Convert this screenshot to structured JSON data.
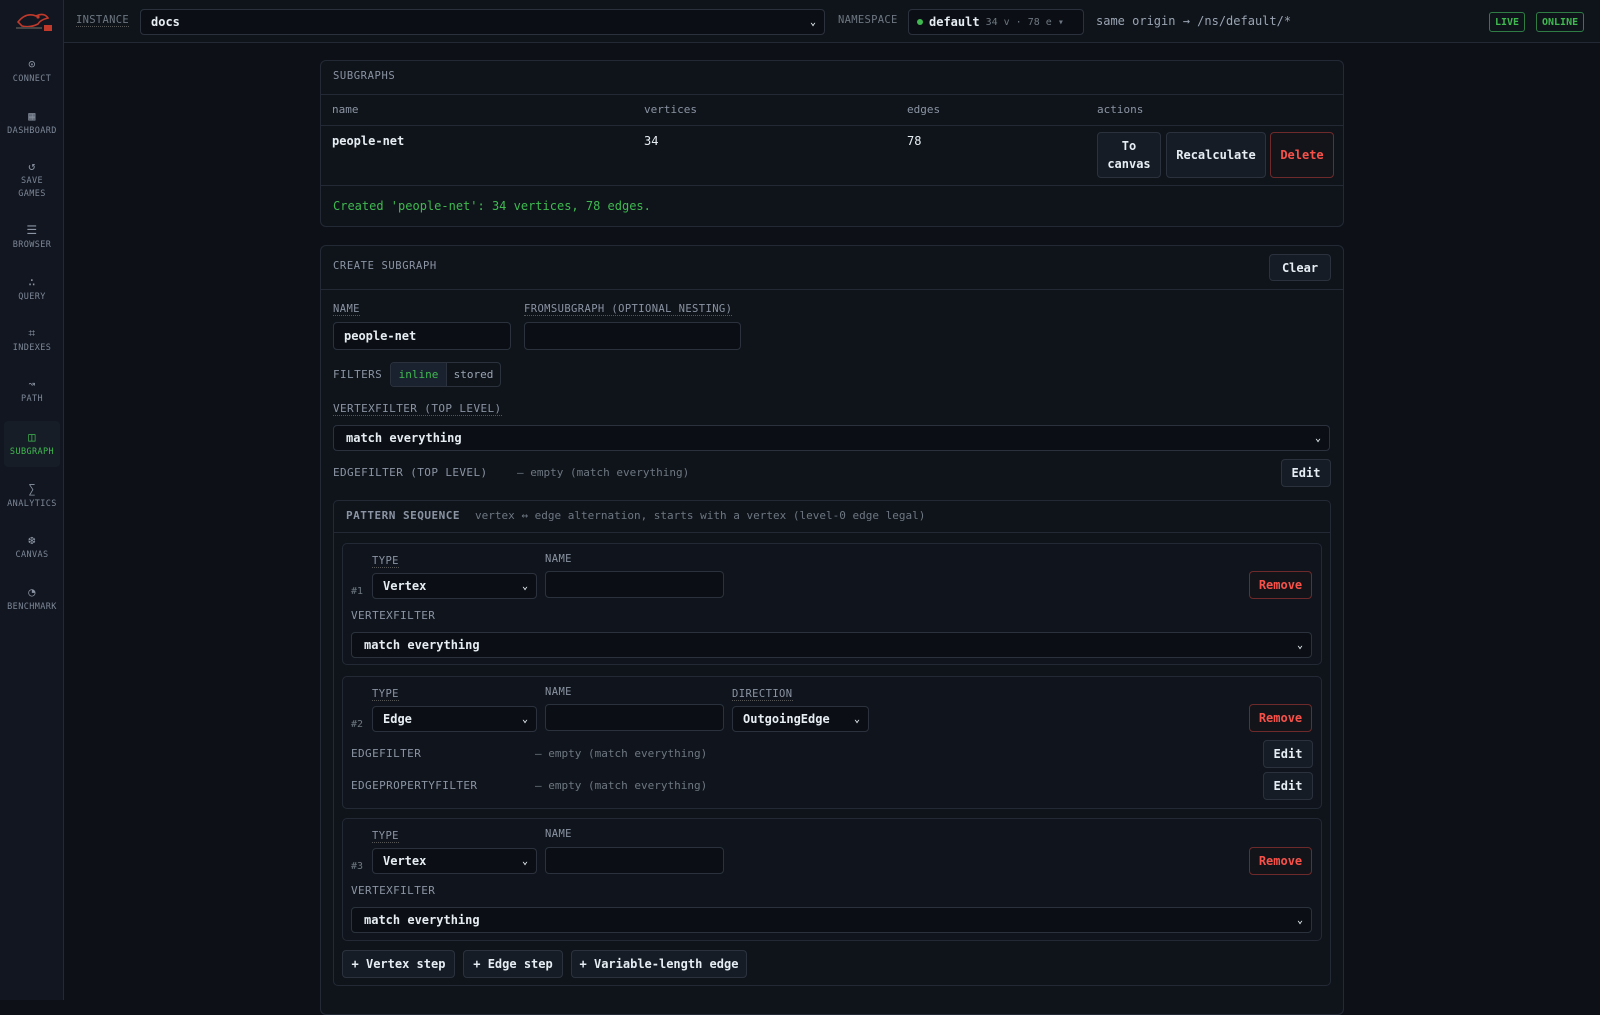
{
  "nav": [
    {
      "label": "CONNECT",
      "icon": "⊙"
    },
    {
      "label": "DASHBOARD",
      "icon": "▦"
    },
    {
      "label": "SAVE GAMES",
      "icon": "↺"
    },
    {
      "label": "BROWSER",
      "icon": "☰"
    },
    {
      "label": "QUERY",
      "icon": "∴"
    },
    {
      "label": "INDEXES",
      "icon": "⌗"
    },
    {
      "label": "PATH",
      "icon": "↝"
    },
    {
      "label": "SUBGRAPH",
      "icon": "◫"
    },
    {
      "label": "ANALYTICS",
      "icon": "∑"
    },
    {
      "label": "CANVAS",
      "icon": "❆"
    },
    {
      "label": "BENCHMARK",
      "icon": "◔"
    }
  ],
  "top": {
    "instance_label": "INSTANCE",
    "instance_value": "docs",
    "namespace_label": "NAMESPACE",
    "namespace_value": "default",
    "namespace_stats": "34 v · 78 e ▾",
    "origin_text": "same origin → /ns/default/*",
    "live": "LIVE",
    "online": "ONLINE"
  },
  "subgraphs": {
    "title": "SUBGRAPHS",
    "columns": [
      "name",
      "vertices",
      "edges",
      "actions"
    ],
    "row": {
      "name": "people-net",
      "vertices": "34",
      "edges": "78"
    },
    "to_canvas": "To canvas",
    "recalculate": "Recalculate",
    "delete": "Delete",
    "message": "Created 'people-net': 34 vertices, 78 edges."
  },
  "create": {
    "title": "CREATE SUBGRAPH",
    "clear": "Clear",
    "name_label": "NAME",
    "name_value": "people-net",
    "from_label": "FROMSUBGRAPH (OPTIONAL NESTING)",
    "filters_label": "FILTERS",
    "inline": "inline",
    "stored": "stored",
    "vf_label": "VERTEXFILTER (TOP LEVEL)",
    "vf_value": "match everything",
    "ef_label": "EDGEFILTER (TOP LEVEL)",
    "ef_value": "— empty (match everything)",
    "edit": "Edit",
    "pattern_title": "PATTERN SEQUENCE",
    "pattern_hint": "vertex ↔ edge alternation, starts with a vertex (level-0 edge legal)"
  },
  "steps": {
    "type_label": "TYPE",
    "name_label": "NAME",
    "direction_label": "DIRECTION",
    "remove": "Remove",
    "vertexfilter_label": "VERTEXFILTER",
    "edgefilter_label": "EDGEFILTER",
    "edgeprop_label": "EDGEPROPERTYFILTER",
    "match": "match everything",
    "empty": "— empty (match everything)",
    "edit": "Edit",
    "s1": {
      "num": "#1",
      "type": "Vertex"
    },
    "s2": {
      "num": "#2",
      "type": "Edge",
      "direction": "OutgoingEdge"
    },
    "s3": {
      "num": "#3",
      "type": "Vertex"
    }
  },
  "add": {
    "vertex": "+ Vertex step",
    "edge": "+ Edge step",
    "varlen": "+ Variable-length edge"
  },
  "colors": {
    "accent": "#3fb950",
    "danger": "#f85149",
    "bg": "#0d1117"
  }
}
